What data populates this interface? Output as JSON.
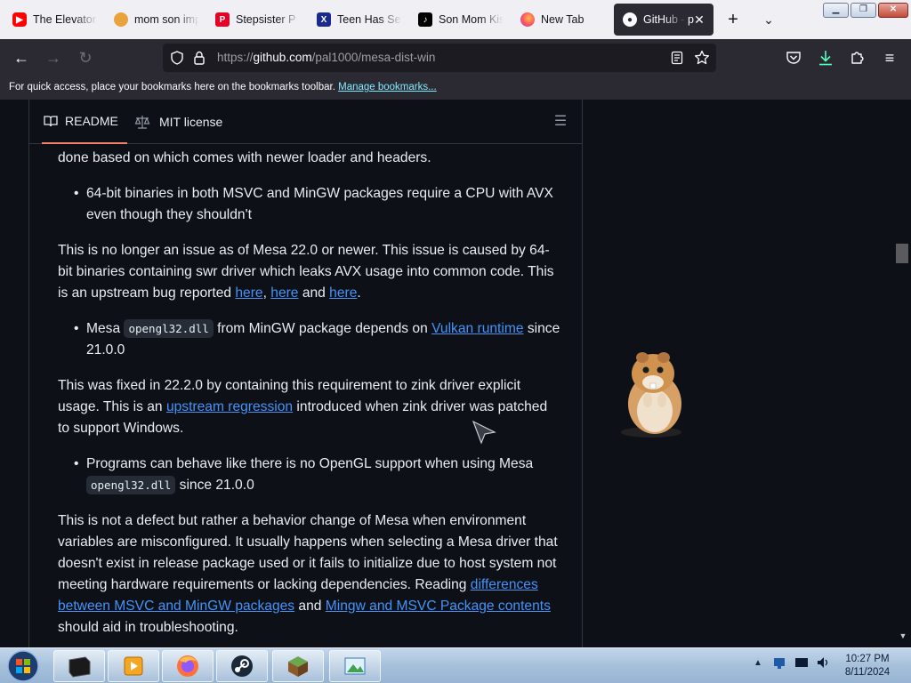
{
  "browser": {
    "tabs": [
      {
        "title": "The Elevator",
        "icon": "youtube-icon"
      },
      {
        "title": "mom son imp",
        "icon": "fox-favicon"
      },
      {
        "title": "Stepsister P",
        "icon": "pinterest-icon"
      },
      {
        "title": "Teen Has Sex",
        "icon": "x-favicon"
      },
      {
        "title": "Son Mom Kis",
        "icon": "tiktok-icon"
      },
      {
        "title": "New Tab",
        "icon": "firefox-icon"
      },
      {
        "title": "GitHub - p",
        "icon": "github-icon"
      }
    ],
    "url_prefix": "https://",
    "url_host": "github.com",
    "url_path": "/pal1000/mesa-dist-win",
    "bookmarks_text": "For quick access, place your bookmarks here on the bookmarks toolbar.",
    "bookmarks_link": "Manage bookmarks..."
  },
  "readme": {
    "tab_readme": "README",
    "tab_license": "MIT license",
    "p0": "done based on which comes with newer loader and headers.",
    "b1": "64-bit binaries in both MSVC and MinGW packages require a CPU with AVX even though they shouldn't",
    "p1a": "This is no longer an issue as of Mesa 22.0 or newer. This issue is caused by 64-bit binaries containing swr driver which leaks AVX usage into common code. This is an upstream bug reported ",
    "p1_link1": "here",
    "p1_sep1": ", ",
    "p1_link2": "here",
    "p1_sep2": " and ",
    "p1_link3": "here",
    "p1_end": ".",
    "b2a": "Mesa ",
    "b2_code": "opengl32.dll",
    "b2b": " from MinGW package depends on ",
    "b2_link": "Vulkan runtime",
    "b2c": " since 21.0.0",
    "p2a": "This was fixed in 22.2.0 by containing this requirement to zink driver explicit usage. This is an ",
    "p2_link": "upstream regression",
    "p2b": " introduced when zink driver was patched to support Windows.",
    "b3a": "Programs can behave like there is no OpenGL support when using Mesa ",
    "b3_code": "opengl32.dll",
    "b3b": " since 21.0.0",
    "p3a": "This is not a defect but rather a behavior change of Mesa when environment variables are misconfigured. It usually happens when selecting a Mesa driver that doesn't exist in release package used or it fails to initialize due to host system not meeting hardware requirements or lacking dependencies. Reading ",
    "p3_link1": "differences between MSVC and MinGW packages",
    "p3_mid": " and ",
    "p3_link2": "Mingw and MSVC Package contents",
    "p3b": " should aid in troubleshooting."
  },
  "taskbar": {
    "time": "10:27 PM",
    "date": "8/11/2024"
  },
  "colors": {
    "link": "#4493f8",
    "tab_underline": "#f78166",
    "page_bg": "#0d1117",
    "text": "#e6edf3"
  }
}
